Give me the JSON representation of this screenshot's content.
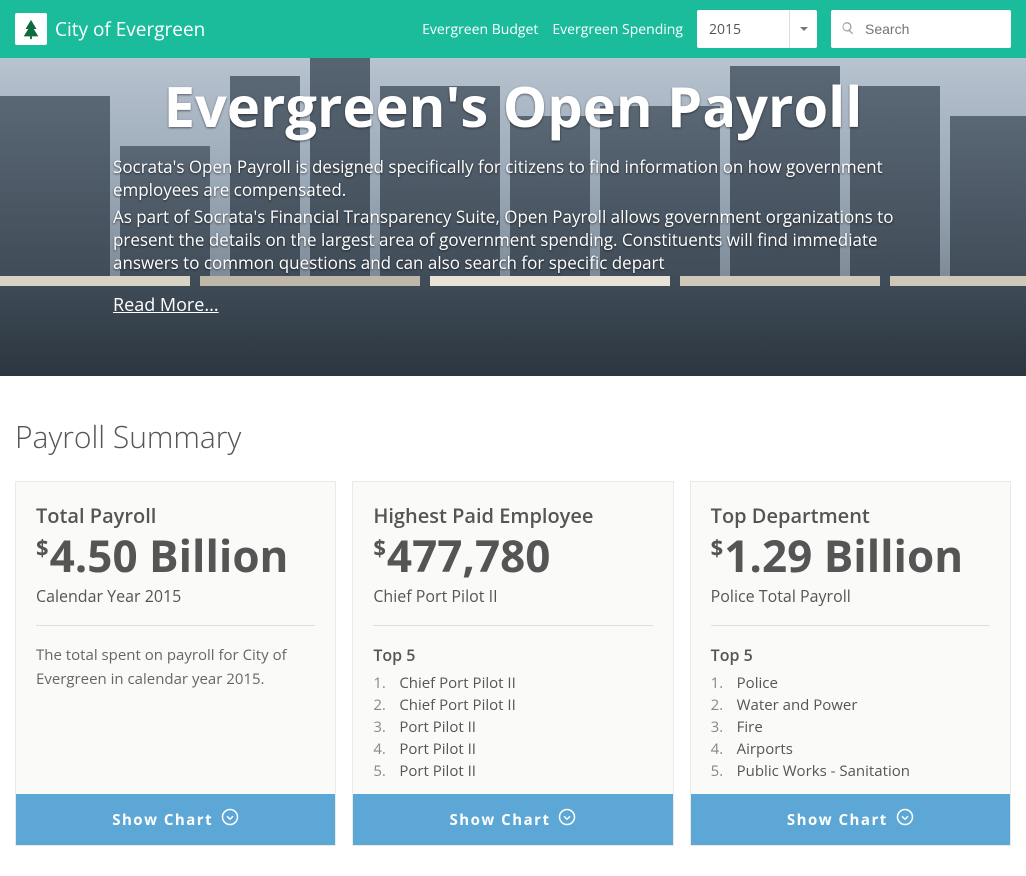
{
  "header": {
    "brand": "City of Evergreen",
    "links": [
      "Evergreen Budget",
      "Evergreen Spending"
    ],
    "year_selected": "2015",
    "search_placeholder": "Search"
  },
  "hero": {
    "title": "Evergreen's Open Payroll",
    "para1": "Socrata's Open Payroll is designed specifically for citizens to find information on how government employees are compensated.",
    "para2": "As part of Socrata's Financial Transparency Suite, Open Payroll allows government organizations to present the details on the largest area of government spending. Constituents will find immediate answers to common questions and can also search for specific depart",
    "readmore": "Read More..."
  },
  "summary": {
    "section_title": "Payroll Summary",
    "show_chart": "Show Chart",
    "top5_label": "Top 5",
    "cards": [
      {
        "heading": "Total Payroll",
        "value": "4.50 Billion",
        "sub": "Calendar Year 2015",
        "desc": "The total spent on payroll for City of Evergreen in calendar year 2015."
      },
      {
        "heading": "Highest Paid Employee",
        "value": "477,780",
        "sub": "Chief Port Pilot II",
        "top5": [
          "Chief Port Pilot II",
          "Chief Port Pilot II",
          "Port Pilot II",
          "Port Pilot II",
          "Port Pilot II"
        ]
      },
      {
        "heading": "Top Department",
        "value": "1.29 Billion",
        "sub": "Police Total Payroll",
        "top5": [
          "Police",
          "Water and Power",
          "Fire",
          "Airports",
          "Public Works - Sanitation"
        ]
      }
    ]
  }
}
